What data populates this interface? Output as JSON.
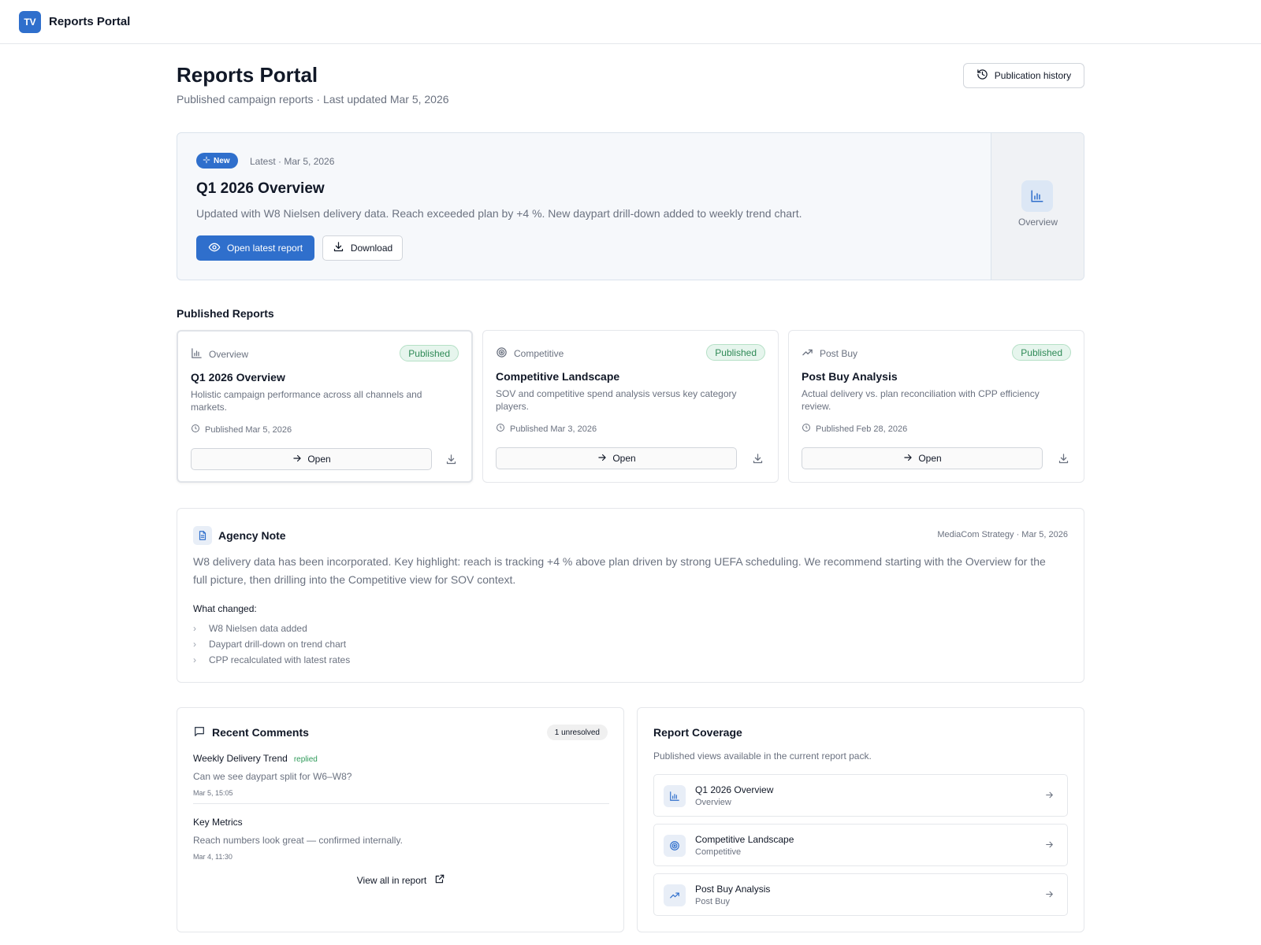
{
  "app": {
    "logo_text": "TV",
    "title": "Reports Portal"
  },
  "header": {
    "title": "Reports Portal",
    "subtitle": "Published campaign reports · Last updated Mar 5, 2026",
    "history_button": "Publication history"
  },
  "hero": {
    "badge": "New",
    "meta": "Latest · Mar 5, 2026",
    "title": "Q1 2026 Overview",
    "description": "Updated with W8 Nielsen delivery data. Reach exceeded plan by +4 %. New daypart drill-down added to weekly trend chart.",
    "open_button": "Open latest report",
    "download_button": "Download",
    "side_label": "Overview"
  },
  "published": {
    "section_title": "Published Reports",
    "cards": [
      {
        "category": "Overview",
        "icon": "bar-chart-icon",
        "status": "Published",
        "title": "Q1 2026 Overview",
        "description": "Holistic campaign performance across all channels and markets.",
        "date": "Published Mar 5, 2026",
        "open_label": "Open"
      },
      {
        "category": "Competitive",
        "icon": "target-icon",
        "status": "Published",
        "title": "Competitive Landscape",
        "description": "SOV and competitive spend analysis versus key category players.",
        "date": "Published Mar 3, 2026",
        "open_label": "Open"
      },
      {
        "category": "Post Buy",
        "icon": "trending-up-icon",
        "status": "Published",
        "title": "Post Buy Analysis",
        "description": "Actual delivery vs. plan reconciliation with CPP efficiency review.",
        "date": "Published Feb 28, 2026",
        "open_label": "Open"
      }
    ]
  },
  "note": {
    "title": "Agency Note",
    "meta": "MediaCom Strategy · Mar 5, 2026",
    "body": "W8 delivery data has been incorporated. Key highlight: reach is tracking +4 % above plan driven by strong UEFA scheduling. We recommend starting with the Overview for the full picture, then drilling into the Competitive view for SOV context.",
    "changes_label": "What changed:",
    "changes": [
      "W8 Nielsen data added",
      "Daypart drill-down on trend chart",
      "CPP recalculated with latest rates"
    ]
  },
  "comments": {
    "title": "Recent Comments",
    "badge": "1 unresolved",
    "items": [
      {
        "title": "Weekly Delivery Trend",
        "status": "replied",
        "text": "Can we see daypart split for W6–W8?",
        "time": "Mar 5, 15:05"
      },
      {
        "title": "Key Metrics",
        "status": "",
        "text": "Reach numbers look great — confirmed internally.",
        "time": "Mar 4, 11:30"
      }
    ],
    "view_all": "View all in report"
  },
  "coverage": {
    "title": "Report Coverage",
    "subtitle": "Published views available in the current report pack.",
    "items": [
      {
        "name": "Q1 2026 Overview",
        "category": "Overview",
        "icon": "bar-chart-icon"
      },
      {
        "name": "Competitive Landscape",
        "category": "Competitive",
        "icon": "target-icon"
      },
      {
        "name": "Post Buy Analysis",
        "category": "Post Buy",
        "icon": "trending-up-icon"
      }
    ]
  },
  "colors": {
    "accent": "#2f6fcc",
    "success": "#2f8a57",
    "muted": "#6b7280"
  }
}
